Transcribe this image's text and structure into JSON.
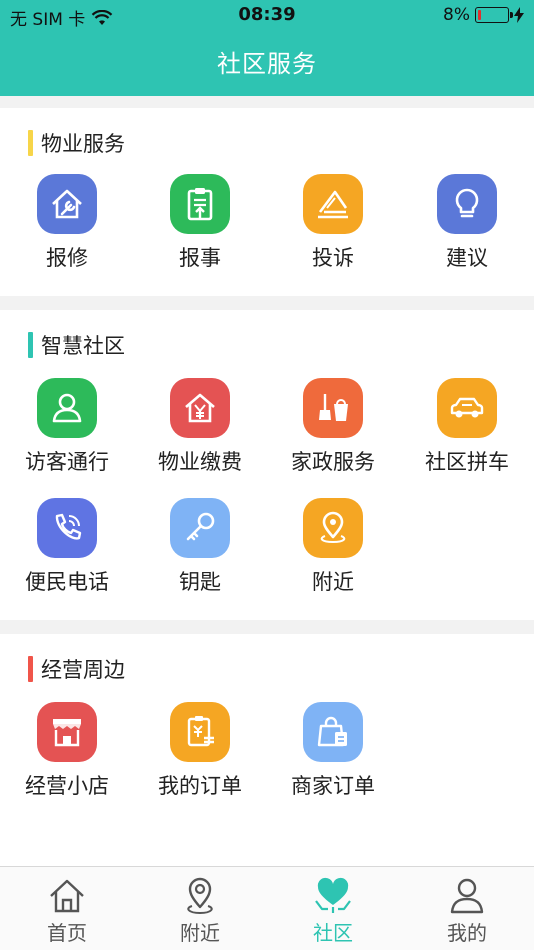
{
  "status_bar": {
    "carrier": "无 SIM 卡",
    "time": "08:39",
    "battery_text": "8%",
    "battery_level": 0.08
  },
  "header": {
    "title": "社区服务"
  },
  "sections": [
    {
      "title": "物业服务",
      "accent": "#f7d549",
      "items": [
        {
          "label": "报修",
          "icon": "house-wrench-icon",
          "color": "#5b78d8"
        },
        {
          "label": "报事",
          "icon": "clipboard-icon",
          "color": "#2dba5a"
        },
        {
          "label": "投诉",
          "icon": "complaint-icon",
          "color": "#f5a623"
        },
        {
          "label": "建议",
          "icon": "lightbulb-icon",
          "color": "#5b78d8"
        }
      ]
    },
    {
      "title": "智慧社区",
      "accent": "#2ec4b2",
      "items": [
        {
          "label": "访客通行",
          "icon": "visitor-icon",
          "color": "#2dba5a"
        },
        {
          "label": "物业缴费",
          "icon": "yuan-house-icon",
          "color": "#e45353"
        },
        {
          "label": "家政服务",
          "icon": "broom-bucket-icon",
          "color": "#ef6a3c"
        },
        {
          "label": "社区拼车",
          "icon": "car-icon",
          "color": "#f5a623"
        },
        {
          "label": "便民电话",
          "icon": "phone-icon",
          "color": "#5f74e3"
        },
        {
          "label": "钥匙",
          "icon": "key-icon",
          "color": "#7fb3f5"
        },
        {
          "label": "附近",
          "icon": "location-pin-icon",
          "color": "#f5a623"
        }
      ]
    },
    {
      "title": "经营周边",
      "accent": "#f0554a",
      "items": [
        {
          "label": "经营小店",
          "icon": "shop-icon",
          "color": "#e45353"
        },
        {
          "label": "我的订单",
          "icon": "order-icon",
          "color": "#f5a623"
        },
        {
          "label": "商家订单",
          "icon": "shopping-bag-icon",
          "color": "#7fb3f5"
        }
      ]
    }
  ],
  "tabbar": {
    "active_color": "#2ec4b2",
    "tabs": [
      {
        "label": "首页",
        "icon": "home-icon",
        "active": false
      },
      {
        "label": "附近",
        "icon": "location-pin-icon",
        "active": false
      },
      {
        "label": "社区",
        "icon": "community-heart-icon",
        "active": true
      },
      {
        "label": "我的",
        "icon": "user-icon",
        "active": false
      }
    ]
  }
}
